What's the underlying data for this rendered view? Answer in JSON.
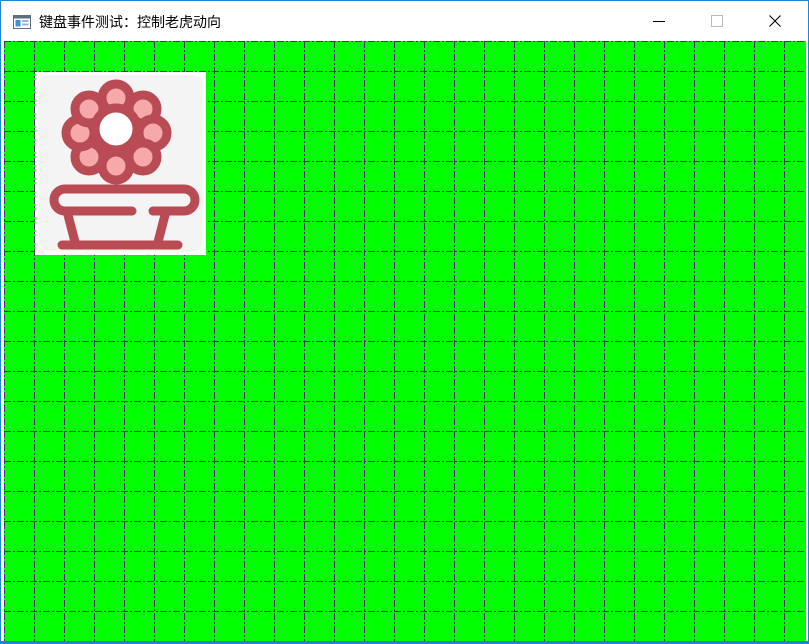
{
  "window": {
    "title": "键盘事件测试：控制老虎动向",
    "icon": "window-app-icon",
    "controls": {
      "minimize_icon": "minimize-icon",
      "maximize_icon": "maximize-icon",
      "close_icon": "close-icon"
    },
    "frame_color": "#1b87d4"
  },
  "canvas": {
    "background_color": "#00ff00",
    "grid_line_color": "#5a2a7a",
    "grid_style": "dash-dot",
    "sprite": {
      "icon": "flower-pot-icon",
      "petal_color": "#f7a8a8",
      "outline_color": "#b84b53"
    }
  }
}
